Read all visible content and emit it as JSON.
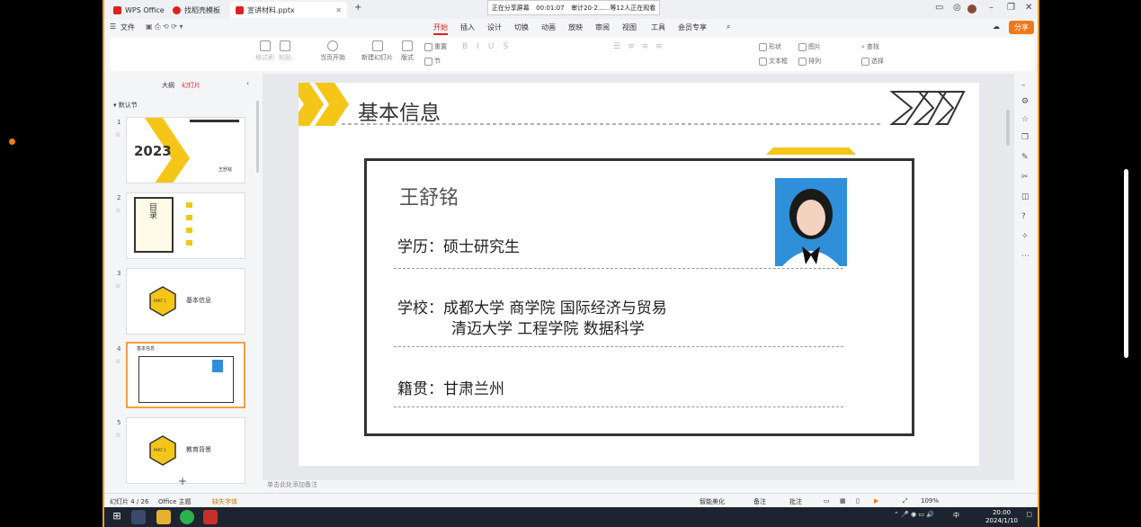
{
  "window": {
    "tabs": [
      {
        "label": "WPS Office",
        "color": "#e0201c"
      },
      {
        "label": "找稻壳模板",
        "color": "#e0201c"
      },
      {
        "label": "宣讲材料.pptx",
        "color": "#e0201c"
      }
    ],
    "share_status": "正在分享屏幕",
    "share_time": "00:01:07",
    "meeting_info": "审计20-2......等12人正在观看"
  },
  "menu": {
    "file": "文件",
    "items": [
      "开始",
      "插入",
      "设计",
      "切换",
      "动画",
      "放映",
      "审阅",
      "视图",
      "工具",
      "会员专享"
    ],
    "active": "开始",
    "share_button": "分享"
  },
  "ribbon": {
    "format_painter": "格式刷",
    "paste": "粘贴",
    "from_current": "当页开始",
    "new_slide": "新建幻灯片",
    "layout": "版式",
    "reset": "重置",
    "section": "节",
    "shape": "形状",
    "picture": "图片",
    "textbox": "文本框",
    "arrange": "排列",
    "find": "查找",
    "select": "选择"
  },
  "left_panel": {
    "tab_outline": "大纲",
    "tab_slides": "幻灯片",
    "section_name": "默认节",
    "slides": [
      {
        "num": "1",
        "title": "2023",
        "sub": "王舒铭"
      },
      {
        "num": "2",
        "title": "目录"
      },
      {
        "num": "3",
        "part": "PART 1",
        "title": "基本信息"
      },
      {
        "num": "4",
        "title": "基本信息",
        "selected": true
      },
      {
        "num": "5",
        "part": "PART 2",
        "title": "教育背景"
      }
    ],
    "add": "+"
  },
  "slide": {
    "title": "基本信息",
    "name": "王舒铭",
    "education": "学历：硕士研究生",
    "school_line1": "学校：成都大学   商学院   国际经济与贸易",
    "school_line2": "清迈大学   工程学院   数据科学",
    "hometown": "籍贯：甘肃兰州",
    "accent": "#f5c518"
  },
  "notes_placeholder": "单击此处添加备注",
  "status": {
    "slide_counter": "幻灯片 4 / 26",
    "theme": "Office 主题",
    "missing_font": "缺失字体",
    "beautify": "智能美化",
    "notes": "备注",
    "comment": "批注",
    "zoom": "109%"
  },
  "taskbar": {
    "ime": "中",
    "time": "20:00",
    "date": "2024/1/10"
  }
}
